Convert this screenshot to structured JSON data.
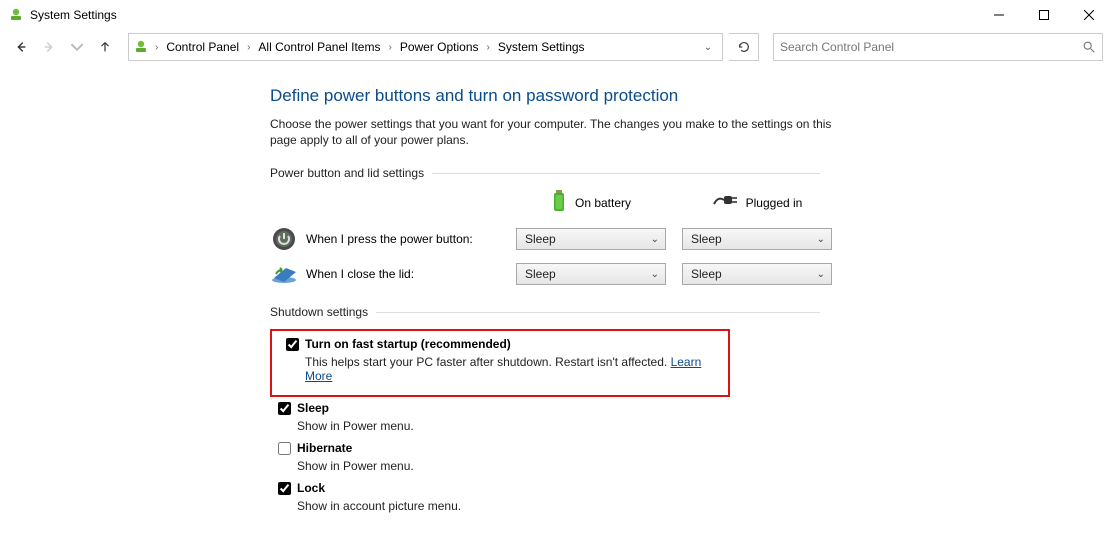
{
  "window": {
    "title": "System Settings"
  },
  "breadcrumb": {
    "items": [
      "Control Panel",
      "All Control Panel Items",
      "Power Options",
      "System Settings"
    ]
  },
  "search": {
    "placeholder": "Search Control Panel"
  },
  "page": {
    "title": "Define power buttons and turn on password protection",
    "description": "Choose the power settings that you want for your computer. The changes you make to the settings on this page apply to all of your power plans."
  },
  "section1": {
    "heading": "Power button and lid settings",
    "col_battery": "On battery",
    "col_plugged": "Plugged in",
    "row_power_btn": "When I press the power button:",
    "row_lid": "When I close the lid:",
    "select_power_battery": "Sleep",
    "select_power_plugged": "Sleep",
    "select_lid_battery": "Sleep",
    "select_lid_plugged": "Sleep"
  },
  "section2": {
    "heading": "Shutdown settings",
    "fast_startup_label": "Turn on fast startup (recommended)",
    "fast_startup_desc": "This helps start your PC faster after shutdown. Restart isn't affected. ",
    "fast_startup_link": "Learn More",
    "sleep_label": "Sleep",
    "sleep_desc": "Show in Power menu.",
    "hibernate_label": "Hibernate",
    "hibernate_desc": "Show in Power menu.",
    "lock_label": "Lock",
    "lock_desc": "Show in account picture menu."
  }
}
